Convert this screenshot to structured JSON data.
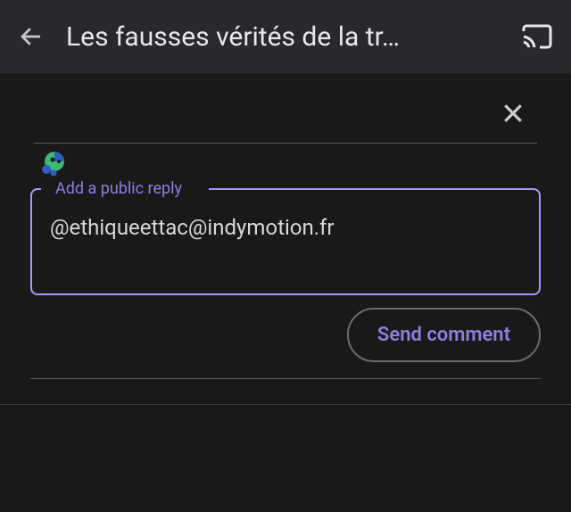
{
  "header": {
    "title": "Les fausses vérités de la tr…"
  },
  "reply": {
    "label": "Add a public reply",
    "value": "@ethiqueettac@indymotion.fr"
  },
  "actions": {
    "send_label": "Send comment"
  },
  "icons": {
    "back": "arrow-left",
    "cast": "cast",
    "close": "close",
    "avatar": "user-avatar"
  }
}
